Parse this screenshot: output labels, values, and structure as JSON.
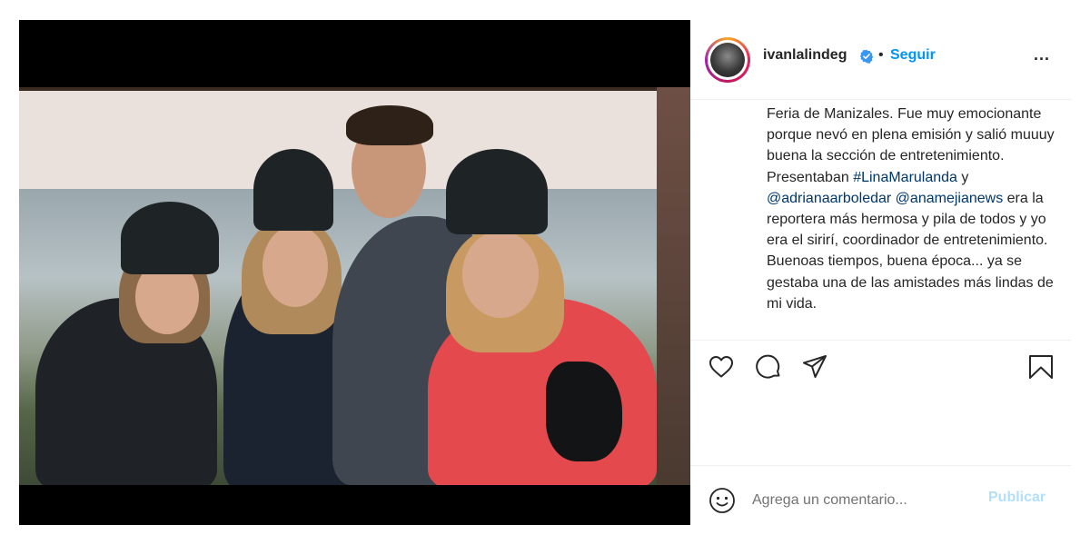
{
  "post": {
    "username": "ivanlalindeg",
    "separator": "•",
    "follow_label": "Seguir",
    "more_label": "...",
    "caption_parts": {
      "p1": "Feria de Manizales. Fue muy emocionante porque nevó en plena emisión y salió muuuy buena la sección de entretenimiento. Presentaban ",
      "tag1": "#LinaMarulanda",
      "p2": " y ",
      "mention1": "@adrianaarboledar",
      "p3": " ",
      "mention2": "@anamejianews",
      "p4": " era la reportera más hermosa y pila de todos y yo era el sirirí, coordinador de entretenimiento. Buenoas tiempos, buena época... ya se gestaba una de las amistades más lindas de mi vida."
    }
  },
  "comment": {
    "placeholder": "Agrega un comentario...",
    "publish_label": "Publicar"
  },
  "icons": {
    "like": "heart-icon",
    "comment": "comment-bubble-icon",
    "share": "paper-plane-icon",
    "save": "bookmark-icon",
    "emoji": "smiley-icon",
    "verified": "verified-badge-icon"
  },
  "colors": {
    "accent": "#0095f6",
    "publish_disabled": "#b2dffc",
    "link": "#00376b",
    "text": "#262626",
    "media_bg": "#000000"
  }
}
